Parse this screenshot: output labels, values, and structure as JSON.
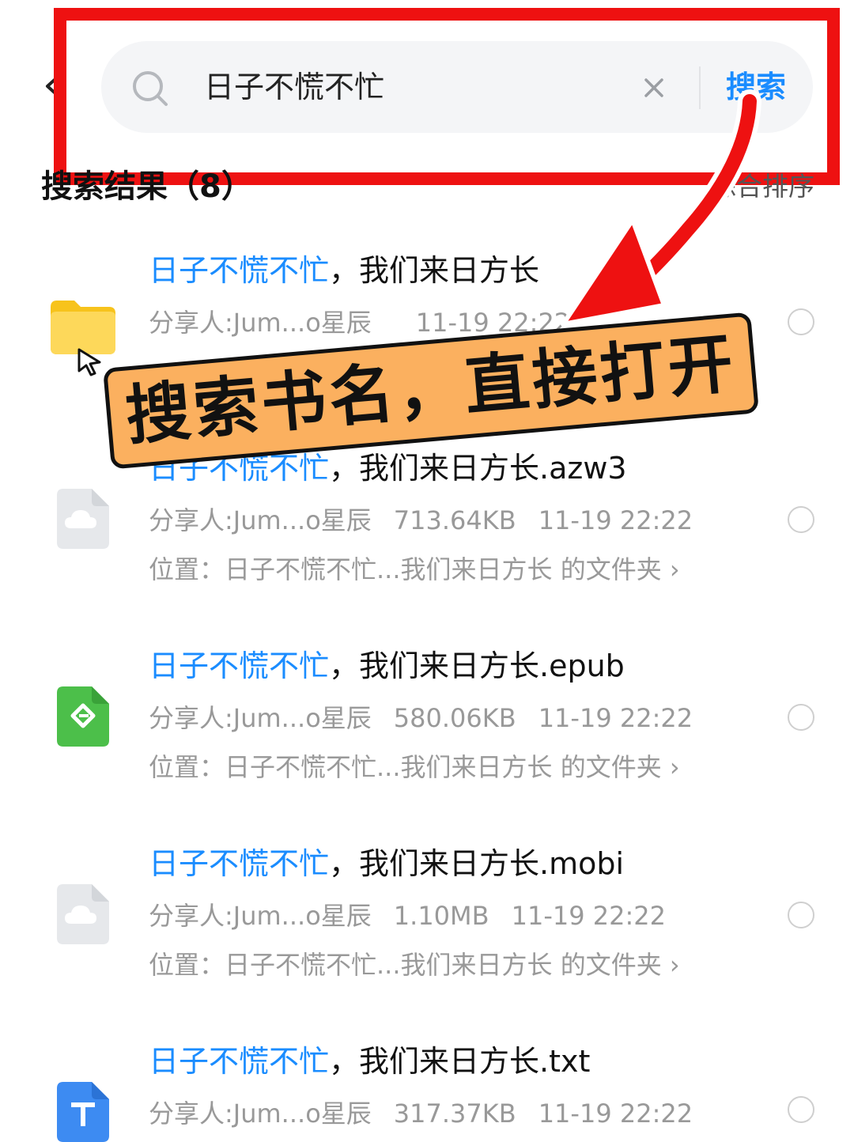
{
  "header": {
    "search_query": "日子不慌不忙",
    "search_button_label": "搜索"
  },
  "results": {
    "title": "搜索结果（8）",
    "sort_label": "综合排序"
  },
  "items": [
    {
      "name_highlight": "日子不慌不忙",
      "name_rest": "，我们来日方长",
      "sharer": "分享人:Jum...o星辰",
      "size": "",
      "date": "11-19 22:22",
      "location": "",
      "icon": "folder-icon"
    },
    {
      "name_highlight": "日子不慌不忙",
      "name_rest": "，我们来日方长.azw3",
      "sharer": "分享人:Jum...o星辰",
      "size": "713.64KB",
      "date": "11-19 22:22",
      "location": "位置：日子不慌不忙...我们来日方长 的文件夹 ›",
      "icon": "cloud-file-icon"
    },
    {
      "name_highlight": "日子不慌不忙",
      "name_rest": "，我们来日方长.epub",
      "sharer": "分享人:Jum...o星辰",
      "size": "580.06KB",
      "date": "11-19 22:22",
      "location": "位置：日子不慌不忙...我们来日方长 的文件夹 ›",
      "icon": "epub-file-icon"
    },
    {
      "name_highlight": "日子不慌不忙",
      "name_rest": "，我们来日方长.mobi",
      "sharer": "分享人:Jum...o星辰",
      "size": "1.10MB",
      "date": "11-19 22:22",
      "location": "位置：日子不慌不忙...我们来日方长 的文件夹 ›",
      "icon": "cloud-file-icon"
    },
    {
      "name_highlight": "日子不慌不忙",
      "name_rest": "，我们来日方长.txt",
      "sharer": "分享人:Jum...o星辰",
      "size": "317.37KB",
      "date": "11-19 22:22",
      "location": "",
      "icon": "txt-file-icon"
    }
  ],
  "annotation": {
    "banner_text": "搜索书名，直接打开",
    "highlight_color": "#ee1111",
    "banner_color": "#fbb05f"
  },
  "colors": {
    "accent": "#1a8cff",
    "meta_text": "#999999"
  }
}
